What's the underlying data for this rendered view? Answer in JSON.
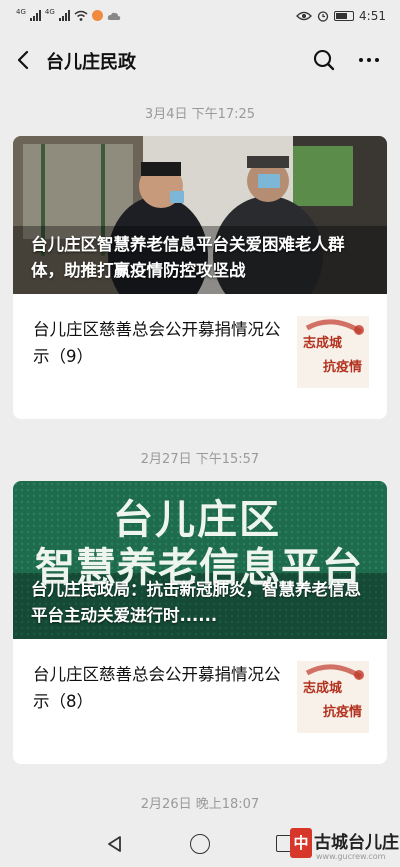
{
  "status_bar": {
    "network_1": "4G",
    "network_2": "4G",
    "time": "4:51"
  },
  "nav": {
    "title": "台儿庄民政"
  },
  "messages": [
    {
      "timestamp": "3月4日 下午17:25",
      "hero_title": "台儿庄区智慧养老信息平台关爱困难老人群体，助推打赢疫情防控攻坚战",
      "sub_title": "台儿庄区慈善总会公开募捐情况公示（9）",
      "thumb_line1": "志成城",
      "thumb_line2": "抗疫情"
    },
    {
      "timestamp": "2月27日 下午15:57",
      "hero_sign_line1": "台儿庄区",
      "hero_sign_line2": "智慧养老信息平台",
      "hero_title": "台儿庄民政局：抗击新冠肺炎，智慧养老信息平台主动关爱进行时......",
      "sub_title": "台儿庄区慈善总会公开募捐情况公示（8）",
      "thumb_line1": "志成城",
      "thumb_line2": "抗疫情"
    }
  ],
  "next_timestamp": "2月26日 晚上18:07",
  "watermark": {
    "logo": "中",
    "text": "古城台儿庄",
    "url": "www.gucrew.com"
  },
  "colors": {
    "background": "#ededed",
    "card": "#ffffff",
    "timestamp": "#9a9a9a",
    "thumb_accent": "#b3321f"
  }
}
